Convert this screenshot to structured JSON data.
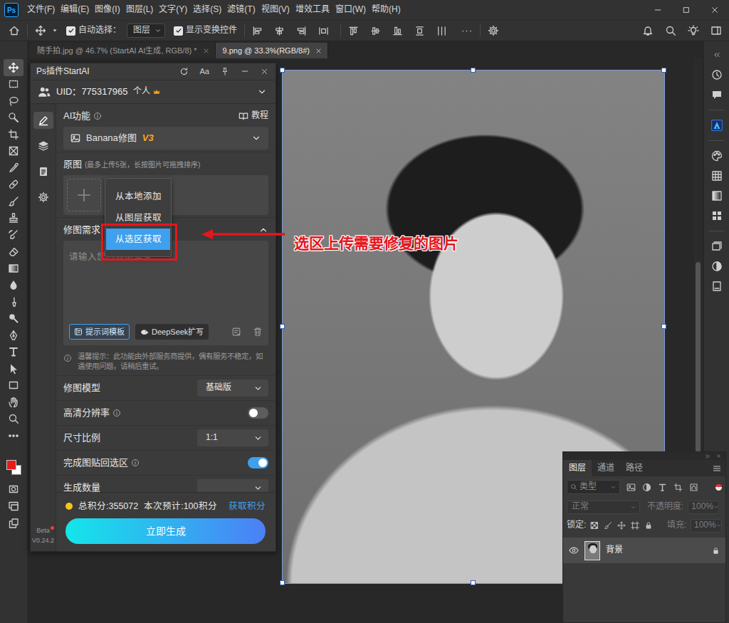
{
  "app": {
    "logo": "Ps"
  },
  "menu": [
    "文件(F)",
    "编辑(E)",
    "图像(I)",
    "图层(L)",
    "文字(Y)",
    "选择(S)",
    "滤镜(T)",
    "视图(V)",
    "增效工具",
    "窗口(W)",
    "帮助(H)"
  ],
  "options_bar": {
    "auto_select": {
      "label": "自动选择：",
      "checked": true
    },
    "target": "图层",
    "show_transform": {
      "label": "显示变换控件",
      "checked": true
    },
    "more": "···"
  },
  "toolbar": {
    "tools": [
      {
        "selected": true
      },
      {
        "selected": false
      },
      {
        "selected": false
      },
      {
        "selected": false
      },
      {
        "selected": false
      },
      {
        "selected": false
      },
      {
        "selected": false
      },
      {
        "selected": false
      },
      {
        "selected": false
      },
      {
        "selected": false
      },
      {
        "selected": false
      },
      {
        "selected": false
      },
      {
        "selected": false
      },
      {
        "selected": false
      },
      {
        "selected": false
      },
      {
        "selected": false
      },
      {
        "selected": false
      },
      {
        "selected": false
      },
      {
        "selected": false
      },
      {
        "selected": false
      },
      {
        "selected": false
      },
      {
        "selected": false
      },
      {
        "selected": false
      }
    ],
    "foreground": "#e81a1a",
    "background": "#ffffff"
  },
  "document_tabs": [
    {
      "label": "随手拍.jpg @ 46.7% (StartAI AI生成, RGB/8) *",
      "selected": false
    },
    {
      "label": "9.png @ 33.3%(RGB/8#)",
      "selected": true
    }
  ],
  "canvas": {
    "vertical_scroll": {
      "position": 0.36,
      "level": 0.34
    }
  },
  "annotation": {
    "text": "选区上传需要修复的图片"
  },
  "plugin": {
    "title": "Ps插件StartAI",
    "font_button": "Aa",
    "account": {
      "uid": "UID：775317965",
      "plan": "个人"
    },
    "side_tabs": [
      {
        "selected": true
      },
      {
        "selected": false
      },
      {
        "selected": false
      },
      {
        "selected": false
      }
    ],
    "beta": "Beta",
    "version": "V0.24.2",
    "ai_function": {
      "label": "AI功能",
      "tutorial": "教程",
      "model": "Banana修图",
      "badge": "V3"
    },
    "source": {
      "label": "原图",
      "hint": "(最多上传5张，长按图片可拖拽排序)",
      "menu": [
        {
          "label": "从本地添加",
          "selected": false
        },
        {
          "label": "从图层获取",
          "selected": false
        },
        {
          "label": "从选区获取",
          "selected": true
        }
      ]
    },
    "requirement": {
      "label": "修图需求",
      "expanded": true,
      "placeholder": "请输入您的修图需求",
      "buttons": [
        "提示词模板",
        "DeepSeek扩写"
      ],
      "notice": "温馨提示：此功能由外部服务商提供，偶有服务不稳定，如遇使用问题，请稍后重试。"
    },
    "settings": [
      {
        "kind": "select",
        "label": "修图模型",
        "info": false,
        "value": "基础版"
      },
      {
        "kind": "toggle",
        "label": "高清分辨率",
        "info": true,
        "on": false
      },
      {
        "kind": "select",
        "label": "尺寸比例",
        "info": false,
        "value": "1:1"
      },
      {
        "kind": "toggle",
        "label": "完成图贴回选区",
        "info": true,
        "on": true
      },
      {
        "kind": "select",
        "label": "生成数量",
        "info": false
      }
    ],
    "footer": {
      "points": "总积分:355072",
      "estimate": "本次预计:100积分",
      "get_points": "获取积分",
      "generate": "立即生成"
    }
  },
  "layers_panel": {
    "tabs": [
      {
        "label": "图层",
        "selected": true
      },
      {
        "label": "通道",
        "selected": false
      },
      {
        "label": "路径",
        "selected": false
      }
    ],
    "filter": "类型",
    "blend": {
      "value": "正常",
      "disabled": true
    },
    "opacity": {
      "label": "不透明度:",
      "value": "100%",
      "disabled": true
    },
    "lock_label": "锁定:",
    "fill": {
      "label": "填充:",
      "value": "100%",
      "disabled": true
    },
    "layers": [
      {
        "name": "背景",
        "visible": true,
        "locked": true,
        "selected": true
      }
    ]
  }
}
